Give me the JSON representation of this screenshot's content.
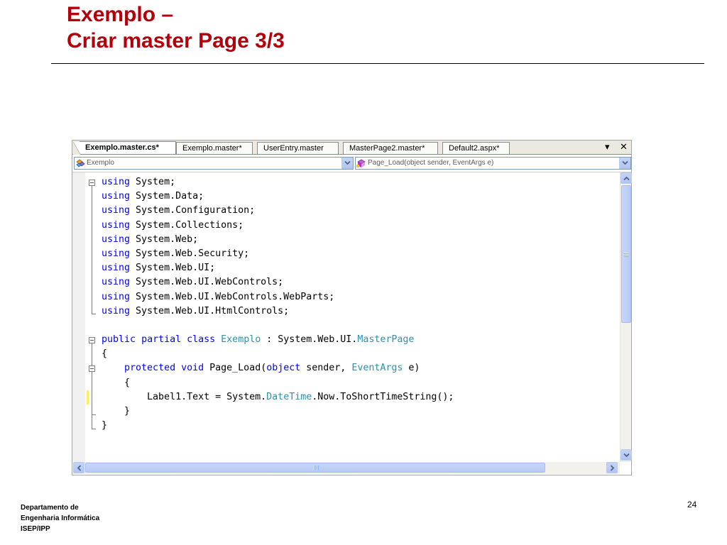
{
  "slide": {
    "title_line1": "Exemplo –",
    "title_line2": "Criar master Page 3/3",
    "footer_line1": "Departamento de",
    "footer_line2": "Engenharia Informática",
    "footer_line3": "ISEP/IPP",
    "page_number": "24"
  },
  "editor": {
    "tabs": [
      {
        "label": "Exemplo.master.cs*",
        "active": true
      },
      {
        "label": "Exemplo.master*",
        "active": false
      },
      {
        "label": "UserEntry.master",
        "active": false
      },
      {
        "label": "MasterPage2.master*",
        "active": false
      },
      {
        "label": "Default2.aspx*",
        "active": false
      }
    ],
    "controls": {
      "pin": "▾",
      "close": "✕"
    },
    "type_dropdown": {
      "value": "Exemplo",
      "icon": "class-icon"
    },
    "member_dropdown": {
      "value": "Page_Load(object sender, EventArgs e)",
      "icon": "method-icon"
    },
    "colors": {
      "keyword": "#0000ff",
      "type": "#2b91af",
      "title": "#b3000b"
    }
  },
  "code_lines": [
    [
      {
        "t": "using",
        "c": "kw"
      },
      {
        "t": " System;"
      }
    ],
    [
      {
        "t": "using",
        "c": "kw"
      },
      {
        "t": " System.Data;"
      }
    ],
    [
      {
        "t": "using",
        "c": "kw"
      },
      {
        "t": " System.Configuration;"
      }
    ],
    [
      {
        "t": "using",
        "c": "kw"
      },
      {
        "t": " System.Collections;"
      }
    ],
    [
      {
        "t": "using",
        "c": "kw"
      },
      {
        "t": " System.Web;"
      }
    ],
    [
      {
        "t": "using",
        "c": "kw"
      },
      {
        "t": " System.Web.Security;"
      }
    ],
    [
      {
        "t": "using",
        "c": "kw"
      },
      {
        "t": " System.Web.UI;"
      }
    ],
    [
      {
        "t": "using",
        "c": "kw"
      },
      {
        "t": " System.Web.UI.WebControls;"
      }
    ],
    [
      {
        "t": "using",
        "c": "kw"
      },
      {
        "t": " System.Web.UI.WebControls.WebParts;"
      }
    ],
    [
      {
        "t": "using",
        "c": "kw"
      },
      {
        "t": " System.Web.UI.HtmlControls;"
      }
    ],
    [],
    [
      {
        "t": "public",
        "c": "kw"
      },
      {
        "t": " "
      },
      {
        "t": "partial",
        "c": "kw"
      },
      {
        "t": " "
      },
      {
        "t": "class",
        "c": "kw"
      },
      {
        "t": " "
      },
      {
        "t": "Exemplo",
        "c": "ty"
      },
      {
        "t": " : System.Web.UI."
      },
      {
        "t": "MasterPage",
        "c": "ty"
      }
    ],
    [
      {
        "t": "{"
      }
    ],
    [
      {
        "t": "    "
      },
      {
        "t": "protected",
        "c": "kw"
      },
      {
        "t": " "
      },
      {
        "t": "void",
        "c": "kw"
      },
      {
        "t": " Page_Load("
      },
      {
        "t": "object",
        "c": "kw"
      },
      {
        "t": " sender, "
      },
      {
        "t": "EventArgs",
        "c": "ty"
      },
      {
        "t": " e)"
      }
    ],
    [
      {
        "t": "    {"
      }
    ],
    [
      {
        "t": "        Label1.Text = System."
      },
      {
        "t": "DateTime",
        "c": "ty"
      },
      {
        "t": ".Now.ToShortTimeString();"
      }
    ],
    [
      {
        "t": "    }"
      }
    ],
    [
      {
        "t": "}"
      }
    ]
  ]
}
